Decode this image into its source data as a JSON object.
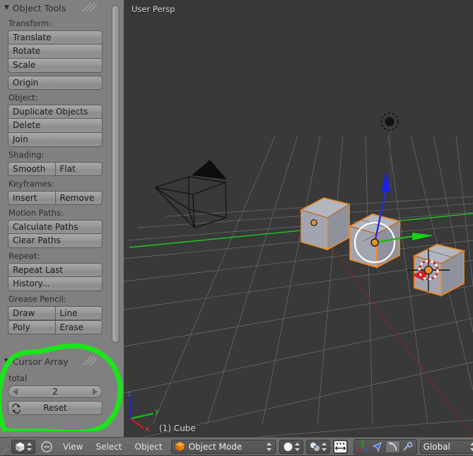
{
  "viewport": {
    "view_label": "User Persp",
    "active_object_label": "(1) Cube",
    "axis_gizmo": {
      "x": "x",
      "y": "y",
      "z": "z"
    },
    "background_color": "#393939",
    "grid_color": "#9a9a9a",
    "y_axis_color": "#1fc71f",
    "x_axis_color": "#7a2a2a",
    "selected_outline_color": "#f08a28",
    "cube_face_color": "#9fa2ad"
  },
  "tool_shelf": {
    "panels": [
      {
        "title": "Object Tools",
        "collapse_icon": "triangle-down-icon",
        "sections": [
          {
            "label": "Transform:",
            "buttons": [
              "Translate",
              "Rotate",
              "Scale"
            ]
          },
          {
            "label": "",
            "buttons": [
              "Origin"
            ]
          },
          {
            "label": "Object:",
            "buttons": [
              "Duplicate Objects",
              "Delete",
              "Join"
            ]
          },
          {
            "label": "Shading:",
            "row": [
              "Smooth",
              "Flat"
            ]
          },
          {
            "label": "Keyframes:",
            "row": [
              "Insert",
              "Remove"
            ]
          },
          {
            "label": "Motion Paths:",
            "buttons": [
              "Calculate Paths",
              "Clear Paths"
            ]
          },
          {
            "label": "Repeat:",
            "buttons": [
              "Repeat Last",
              "History..."
            ]
          },
          {
            "label": "Grease Pencil:",
            "row": [
              "Draw",
              "Line"
            ],
            "row2": [
              "Poly",
              "Erase"
            ]
          }
        ]
      }
    ],
    "cursor_array_panel": {
      "title": "Cursor Array",
      "collapse_icon": "triangle-down-icon",
      "field_label": "total",
      "field_value": "2",
      "reset_label": "Reset",
      "reset_icon": "refresh-icon"
    },
    "annotation": {
      "shape": "hand-drawn-ellipse",
      "color": "#19e619",
      "target": "Cursor Array panel"
    }
  },
  "status_bar": {
    "editor_type_icon": "editor-type-3dview-icon",
    "collapse_icon": "minus-circle-icon",
    "menus": [
      "View",
      "Select",
      "Object"
    ],
    "mode": {
      "label": "Object Mode",
      "icon": "object-mode-cube-icon"
    },
    "shading": {
      "icon": "shading-solid-sphere-icon"
    },
    "pivot": {
      "icon": "pivot-median-point-icon"
    },
    "snap": {
      "icon": "snap-toggle-icon"
    },
    "manipulators": [
      {
        "name": "manipulator-toggle",
        "icon": "axis-widget-icon",
        "active": false
      },
      {
        "name": "translate-manipulator",
        "icon": "arrow-icon",
        "active": false
      },
      {
        "name": "rotate-manipulator",
        "icon": "rotate-arc-icon",
        "active": true
      },
      {
        "name": "scale-manipulator",
        "icon": "scale-handle-icon",
        "active": false
      }
    ],
    "orientation": {
      "label": "Global"
    },
    "layers": {
      "rows": 2,
      "cols": 5,
      "active_index": 0,
      "active_color": "#e8891e"
    }
  }
}
